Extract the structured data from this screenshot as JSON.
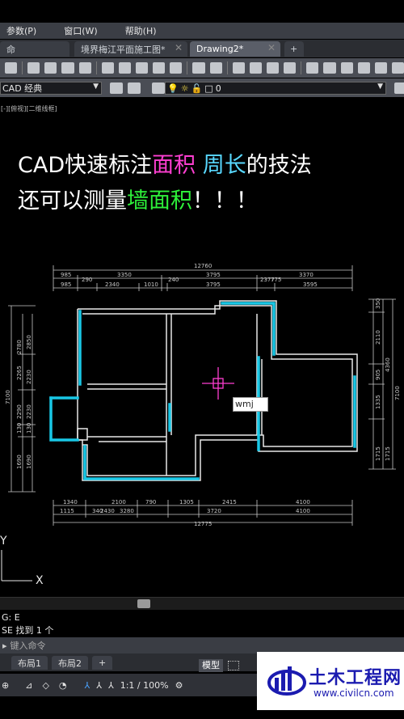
{
  "menu": [
    "参数(P)",
    "窗口(W)",
    "帮助(H)"
  ],
  "tabs": [
    {
      "label": "命"
    },
    {
      "label": "境界梅江平面施工图*"
    },
    {
      "label": "Drawing2*"
    }
  ],
  "tab_add": "+",
  "workspace_combo": "CAD 经典",
  "layer_combo": "0",
  "breadcrumb": "[-][俯视][二维线框]",
  "overlay": {
    "line1_a": "CAD快速标注",
    "line1_b": "面积",
    "line1_c": "周长",
    "line1_d": "的技法",
    "line2_a": "还可以测量",
    "line2_b": "墙面积",
    "line2_c": "！！！"
  },
  "dims": {
    "top_total": "12760",
    "top_row1": [
      "985",
      "3350",
      "3795",
      "3370"
    ],
    "top_row2": [
      "985",
      "290",
      "2340",
      "1010",
      "240",
      "3795",
      "2377",
      "775",
      "3595"
    ],
    "bottom_row1": [
      "1340",
      "2100",
      "790",
      "1305",
      "2415",
      "4100"
    ],
    "bottom_row2": [
      "1115",
      "340",
      "2430",
      "3280",
      "3720",
      "4100"
    ],
    "bottom_total": "12775",
    "left_outer": "7100",
    "left_inner": [
      "2780",
      "2265",
      "2290",
      "130",
      "1690"
    ],
    "left_inner2": [
      "2850",
      "2230",
      "2230",
      "130",
      "1690"
    ],
    "right_outer": "7100",
    "right_inner": [
      "350",
      "2110",
      "905",
      "1335",
      "1715"
    ],
    "right_inner2": [
      "4360",
      "1715"
    ]
  },
  "cursor_input": "wmj",
  "axis_y": "Y",
  "axis_x": "X",
  "cmd_lines": [
    "G: E",
    "SE 找到 1 个"
  ],
  "cmd_placeholder": "键入命令",
  "layout_tabs": [
    "布局1",
    "布局2"
  ],
  "layout_add": "+",
  "status_model": "模型",
  "status_scale": "1:1 / 100%",
  "logo": {
    "name": "土木工程网",
    "url": "www.civilcn.com"
  },
  "colors": {
    "wall": "#e8e8e8",
    "highlight": "#19c7e6",
    "cursor": "#ff3fd2",
    "dim": "#c8c8c8"
  }
}
